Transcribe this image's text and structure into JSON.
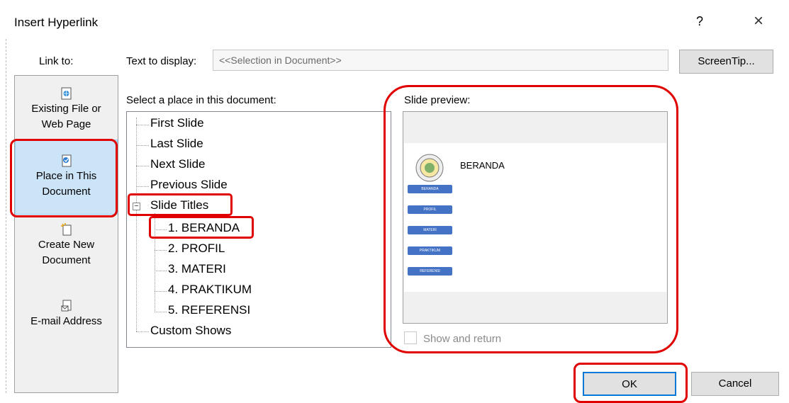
{
  "dialog": {
    "title": "Insert Hyperlink",
    "help_label": "?",
    "close_label": "×"
  },
  "link_to": {
    "label": "Link to:",
    "items": [
      {
        "line1": "Existing File or",
        "line2": "Web Page",
        "icon": "globe-file-icon"
      },
      {
        "line1": "Place in This",
        "line2": "Document",
        "icon": "document-place-icon",
        "selected": true
      },
      {
        "line1": "Create New",
        "line2": "Document",
        "icon": "new-document-icon"
      },
      {
        "line1": "E-mail Address",
        "line2": "",
        "icon": "email-icon"
      }
    ]
  },
  "text_to_display": {
    "label": "Text to display:",
    "value": "<<Selection in Document>>"
  },
  "screentip_label": "ScreenTip...",
  "place_tree": {
    "label": "Select a place in this document:",
    "nodes": [
      {
        "label": "First Slide",
        "level": 0
      },
      {
        "label": "Last Slide",
        "level": 0
      },
      {
        "label": "Next Slide",
        "level": 0
      },
      {
        "label": "Previous Slide",
        "level": 0
      },
      {
        "label": "Slide Titles",
        "level": 0,
        "expanded": true
      },
      {
        "label": "1. BERANDA",
        "level": 1,
        "selected": true
      },
      {
        "label": "2. PROFIL",
        "level": 1
      },
      {
        "label": "3. MATERI",
        "level": 1
      },
      {
        "label": "4. PRAKTIKUM",
        "level": 1
      },
      {
        "label": "5. REFERENSI",
        "level": 1
      },
      {
        "label": "Custom Shows",
        "level": 0
      }
    ]
  },
  "preview": {
    "label": "Slide preview:",
    "slide_title": "BERANDA",
    "buttons": [
      "BERANDA",
      "PROFIL",
      "MATERI",
      "PRAKTIKUM",
      "REFERENSI"
    ]
  },
  "show_and_return": {
    "label": "Show and return",
    "checked": false
  },
  "ok_label": "OK",
  "cancel_label": "Cancel",
  "colors": {
    "highlight_ring": "#e00000",
    "selected_bg": "#cce4f7",
    "slide_button": "#4472c4",
    "default_button_border": "#0078d7"
  }
}
